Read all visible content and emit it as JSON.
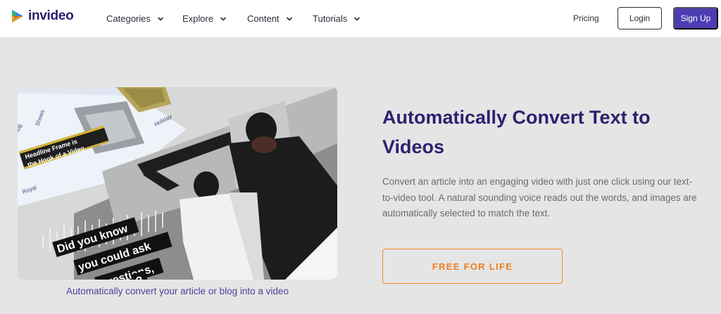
{
  "brand": {
    "name": "invideo",
    "accent": "#4d3db3",
    "text_color": "#2d1d6b",
    "logo_icon": "invideo-play-logo-icon"
  },
  "nav": {
    "items": [
      {
        "label": "Categories",
        "icon": "chevron-down-icon"
      },
      {
        "label": "Explore",
        "icon": "chevron-down-icon"
      },
      {
        "label": "Content",
        "icon": "chevron-down-icon"
      },
      {
        "label": "Tutorials",
        "icon": "chevron-down-icon"
      }
    ],
    "pricing": "Pricing",
    "login": "Login",
    "signup": "Sign Up"
  },
  "hero": {
    "image": {
      "tabs": [
        "log",
        "Shows",
        "Holiday",
        "Royal"
      ],
      "frame_caption": "Headline Frame is the Hook of a Video",
      "overlay_lines": [
        "Did you know",
        "you could ask",
        "questions,",
        "?"
      ]
    },
    "caption": "Automatically convert your article or blog into a video",
    "title": "Automatically Convert Text to Videos",
    "description": "Convert an article into an engaging video with just one click using our text-to-video tool. A natural sounding voice reads out the words, and images are automatically selected to match the text.",
    "cta": "FREE FOR LIFE",
    "cta_color": "#f07c1e",
    "title_color": "#2d2170"
  }
}
